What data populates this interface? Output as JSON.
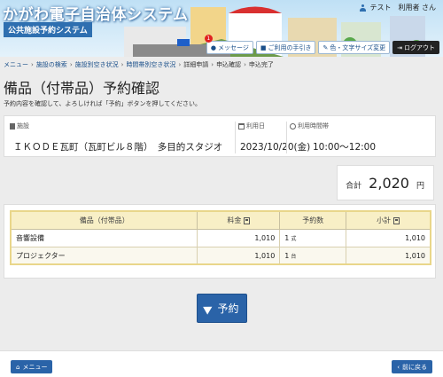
{
  "header": {
    "site_title": "かがわ電子自治体システム",
    "sub_title": "公共施設予約システム",
    "user_name": "テスト　利用者 さん",
    "buttons": {
      "message": "メッセージ",
      "message_count": "1",
      "guide": "ご利用の手引き",
      "color": "色・文字サイズ変更",
      "logout": "ログアウト"
    }
  },
  "breadcrumb": [
    "メニュー",
    "施設の検索",
    "施設別空き状況",
    "時間帯別空き状況",
    "詳細申請",
    "申込確認",
    "申込完了"
  ],
  "page": {
    "title": "備品（付帯品）予約確認",
    "instruction": "予約内容を確認して、よろしければ「予約」ボタンを押してください。"
  },
  "info": {
    "facility_label": "施設",
    "facility_value": "ＩＫＯＤＥ瓦町（瓦町ビル８階）　多目的スタジオ",
    "date_label": "利用日",
    "date_value": "2023/10/20(金)",
    "time_label": "利用時間帯",
    "time_value": "10:00～12:00"
  },
  "total": {
    "label": "合計",
    "value": "2,020",
    "unit": "円"
  },
  "table": {
    "headers": [
      "備品（付帯品）",
      "料金",
      "予約数",
      "小計"
    ],
    "rows": [
      {
        "name": "音響設備",
        "price": "1,010",
        "qty": "1",
        "unit": "式",
        "subtotal": "1,010"
      },
      {
        "name": "プロジェクター",
        "price": "1,010",
        "qty": "1",
        "unit": "台",
        "subtotal": "1,010"
      }
    ]
  },
  "actions": {
    "reserve": "予約"
  },
  "footer": {
    "menu": "メニュー",
    "back": "前に戻る"
  }
}
